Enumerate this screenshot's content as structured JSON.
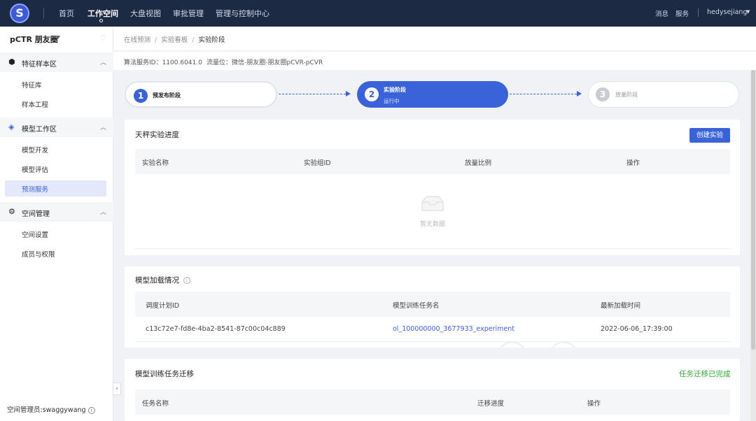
{
  "topbar": {
    "logo_glyph": "S",
    "nav": [
      "首页",
      "工作空间",
      "大盘视图",
      "审批管理",
      "管理与控制中心"
    ],
    "active_nav": "工作空间",
    "right": {
      "messages": "消息",
      "services": "服务",
      "user": "hedysejiang"
    }
  },
  "sidebar": {
    "space_name": "pCTR 朋友圈",
    "groups": [
      {
        "label": "特征样本区",
        "icon": "feature-icon",
        "items": [
          "特征库",
          "样本工程"
        ]
      },
      {
        "label": "模型工作区",
        "icon": "model-icon",
        "items": [
          "模型开发",
          "模型评估",
          "预测服务"
        ]
      },
      {
        "label": "空间管理",
        "icon": "gear-icon",
        "items": [
          "空间设置",
          "成员与权限"
        ]
      }
    ],
    "active_item": "预测服务",
    "footer": "空间管理员:swaggywang"
  },
  "breadcrumb": [
    "在线预测",
    "实验看板",
    "实验阶段"
  ],
  "info": {
    "service_id": "算法服务ID：1100.6041.0",
    "traffic": "流量位：微信-朋友圈-朋友圈pCVR-pCVR"
  },
  "steps": [
    {
      "num": "1",
      "title": "预发布阶段",
      "sub": ""
    },
    {
      "num": "2",
      "title": "实验阶段",
      "sub": "运行中"
    },
    {
      "num": "3",
      "title": "放量阶段",
      "sub": ""
    }
  ],
  "experiment": {
    "title": "天秤实验进度",
    "create_button": "创建实验",
    "columns": [
      "实验名称",
      "实验组ID",
      "放量比例",
      "操作"
    ],
    "empty_text": "暂无数据"
  },
  "model_loading": {
    "title": "模型加载情况",
    "columns": [
      "调度计划ID",
      "模型训练任务名",
      "最新加载时间"
    ],
    "rows": [
      [
        "c13c72e7-fd8e-4ba2-8541-87c00c04c889",
        "ol_100000000_3677933_experiment",
        "2022-06-06_17:39:00"
      ]
    ]
  },
  "migration": {
    "title": "模型训练任务迁移",
    "status": "任务迁移已完成",
    "columns": [
      "任务名称",
      "迁移进度",
      "操作"
    ]
  },
  "colors": {
    "topbar": "#1d2a44",
    "accent": "#3b63d9",
    "success": "#2eaa3a"
  }
}
